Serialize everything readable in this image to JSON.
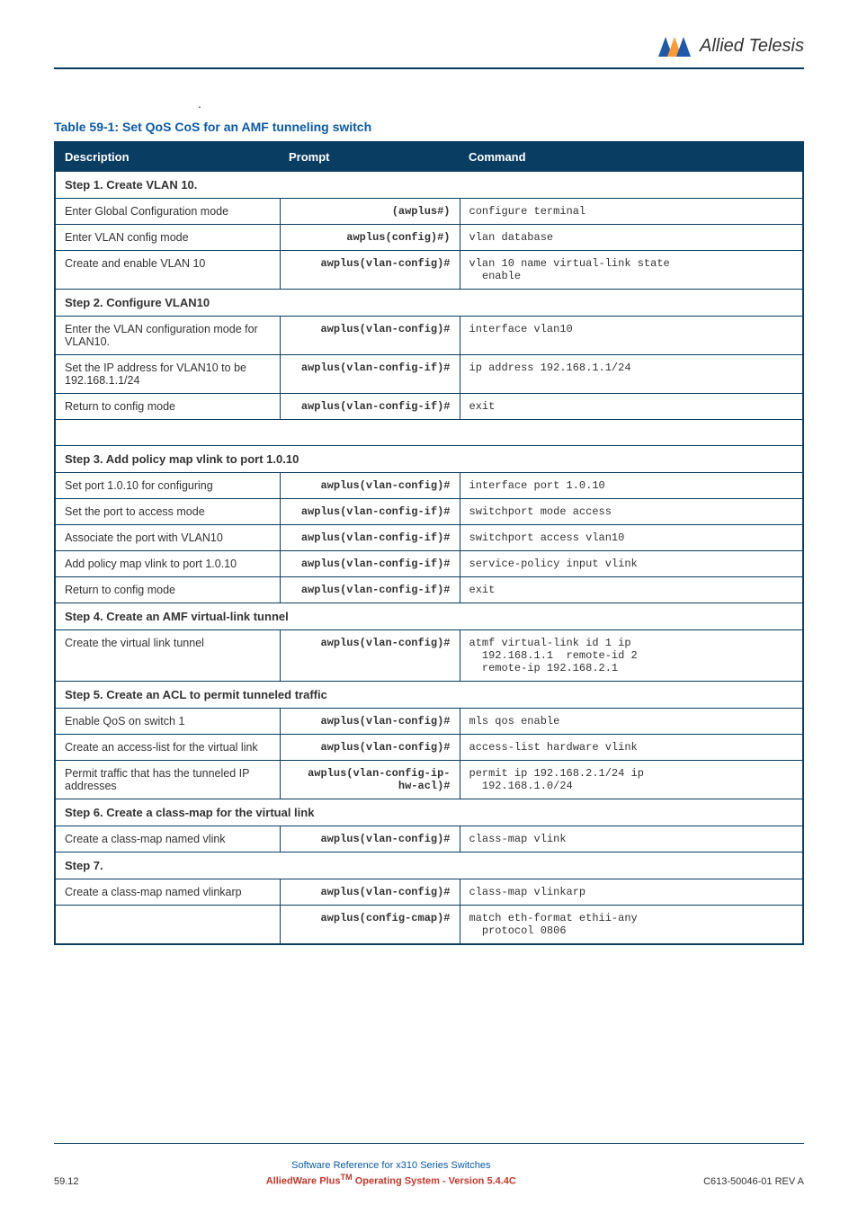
{
  "brand": "Allied Telesis",
  "dot": ".",
  "tableTitle": "Table 59-1: Set QoS CoS for an AMF tunneling switch",
  "headers": {
    "desc": "Description",
    "prompt": "Prompt",
    "cmd": "Command"
  },
  "step1": {
    "title": "Step 1. Create VLAN 10.",
    "r1": {
      "desc": "Enter Global Configuration mode",
      "prompt": "(awplus#)",
      "cmd": "configure terminal"
    },
    "r2": {
      "desc": "Enter VLAN config mode",
      "prompt": "awplus(config)#)",
      "cmd": "vlan database"
    },
    "r3": {
      "desc": "Create and enable VLAN 10",
      "prompt": "awplus(vlan-config)#",
      "cmd": "vlan 10 name virtual-link state\n  enable"
    }
  },
  "step2": {
    "title": "Step 2. Configure VLAN10",
    "r1": {
      "desc": "Enter the VLAN configuration mode for VLAN10.",
      "prompt": "awplus(vlan-config)#",
      "cmd": "interface vlan10"
    },
    "r2": {
      "desc": "Set the IP address for VLAN10 to be 192.168.1.1/24",
      "prompt": "awplus(vlan-config-if)#",
      "cmd": "ip address 192.168.1.1/24"
    },
    "r3": {
      "desc": "Return to config mode",
      "prompt": "awplus(vlan-config-if)#",
      "cmd": "exit"
    }
  },
  "step3": {
    "title": "Step 3. Add policy map vlink to port 1.0.10",
    "r1": {
      "desc": "Set port 1.0.10 for configuring",
      "prompt": "awplus(vlan-config)#",
      "cmd": "interface port 1.0.10"
    },
    "r2": {
      "desc": "Set the port to access mode",
      "prompt": "awplus(vlan-config-if)#",
      "cmd": "switchport mode access"
    },
    "r3": {
      "desc": "Associate the port with VLAN10",
      "prompt": "awplus(vlan-config-if)#",
      "cmd": "switchport access vlan10"
    },
    "r4": {
      "desc": "Add policy map vlink to port 1.0.10",
      "prompt": "awplus(vlan-config-if)#",
      "cmd": "service-policy input vlink"
    },
    "r5": {
      "desc": "Return to config mode",
      "prompt": "awplus(vlan-config-if)#",
      "cmd": "exit"
    }
  },
  "step4": {
    "title": "Step 4. Create an AMF virtual-link tunnel",
    "r1": {
      "desc": "Create the virtual link tunnel",
      "prompt": "awplus(vlan-config)#",
      "cmd": "atmf virtual-link id 1 ip\n  192.168.1.1  remote-id 2\n  remote-ip 192.168.2.1"
    }
  },
  "step5": {
    "title": "Step 5. Create an ACL to permit tunneled traffic",
    "r1": {
      "desc": "Enable QoS on switch 1",
      "prompt": "awplus(vlan-config)#",
      "cmd": "mls qos enable"
    },
    "r2": {
      "desc": "Create an access-list for the virtual link",
      "prompt": "awplus(vlan-config)#",
      "cmd": "access-list hardware vlink"
    },
    "r3": {
      "desc": "Permit traffic that has the tunneled IP addresses",
      "prompt": "awplus(vlan-config-ip-\nhw-acl)#",
      "cmd": "permit ip 192.168.2.1/24 ip\n  192.168.1.0/24"
    }
  },
  "step6": {
    "title": "Step 6. Create a class-map for the virtual link",
    "r1": {
      "desc": "Create a class-map named vlink",
      "prompt": "awplus(vlan-config)#",
      "cmd": "class-map vlink"
    }
  },
  "step7": {
    "title": "Step 7.",
    "r1": {
      "desc": "Create a class-map named vlinkarp",
      "prompt": "awplus(vlan-config)#",
      "cmd": "class-map vlinkarp"
    },
    "r2": {
      "desc": "",
      "prompt": "awplus(config-cmap)#",
      "cmd": "match eth-format ethii-any\n  protocol 0806"
    }
  },
  "footer": {
    "left": "59.12",
    "centerLine1": "Software Reference for x310 Series Switches",
    "centerLine2a": "AlliedWare Plus",
    "centerLine2b": "TM",
    "centerLine2c": " Operating System  - Version 5.4.4C",
    "right": "C613-50046-01 REV A"
  }
}
